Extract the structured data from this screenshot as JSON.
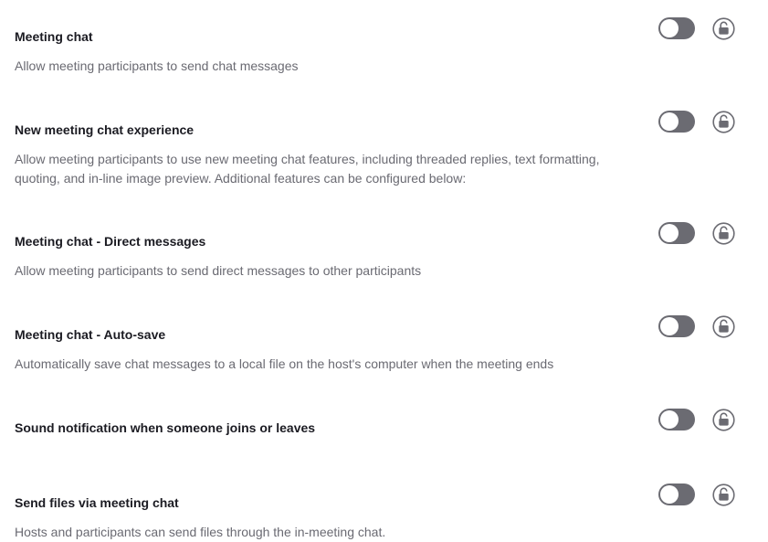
{
  "settings": [
    {
      "title": "Meeting chat",
      "description": "Allow meeting participants to send chat messages",
      "toggle_on": false,
      "lock_icon": "unlock-icon"
    },
    {
      "title": "New meeting chat experience",
      "description": "Allow meeting participants to use new meeting chat features, including threaded replies, text formatting, quoting, and in-line image preview. Additional features can be configured below:",
      "toggle_on": false,
      "lock_icon": "unlock-icon"
    },
    {
      "title": "Meeting chat - Direct messages",
      "description": "Allow meeting participants to send direct messages to other participants",
      "toggle_on": false,
      "lock_icon": "unlock-icon"
    },
    {
      "title": "Meeting chat - Auto-save",
      "description": "Automatically save chat messages to a local file on the host's computer when the meeting ends",
      "toggle_on": false,
      "lock_icon": "unlock-icon"
    },
    {
      "title": "Sound notification when someone joins or leaves",
      "description": "",
      "toggle_on": false,
      "lock_icon": "unlock-icon"
    },
    {
      "title": "Send files via meeting chat",
      "description": "Hosts and participants can send files through the in-meeting chat.",
      "toggle_on": false,
      "lock_icon": "unlock-icon"
    }
  ],
  "colors": {
    "toggle_off": "#6b6b72",
    "title": "#1b1b22",
    "description": "#6a6a72",
    "lock": "#6b6b72"
  }
}
